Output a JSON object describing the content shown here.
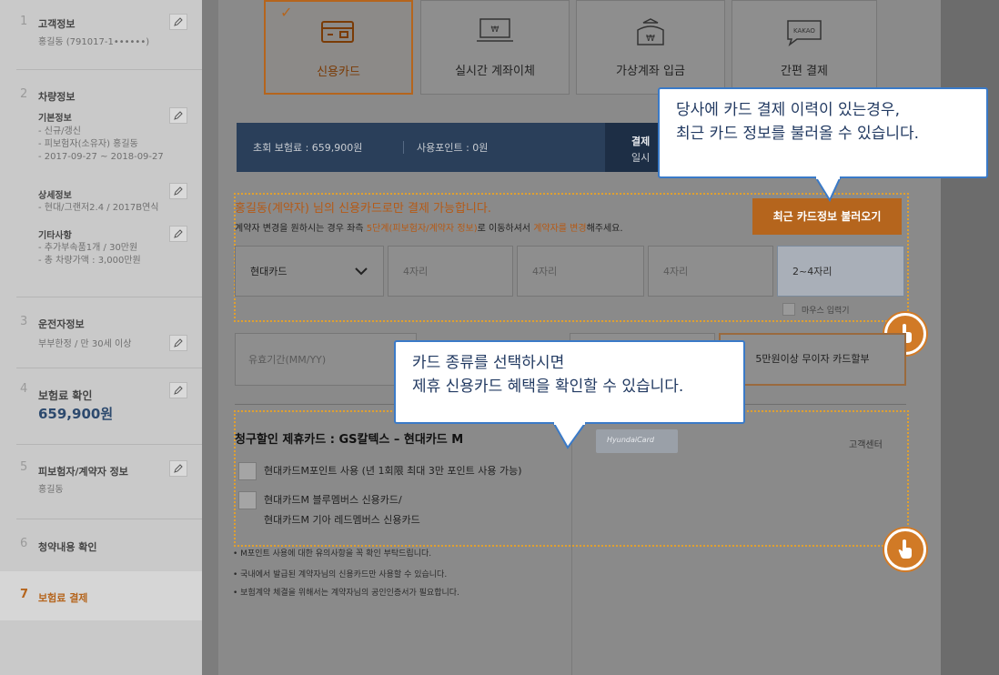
{
  "sidebar": {
    "steps": [
      {
        "num": "1",
        "title": "고객정보",
        "lines": [
          "홍길동 (791017-1••••••)"
        ]
      },
      {
        "num": "2",
        "title": "차량정보",
        "groups": [
          {
            "subtitle": "기본정보",
            "lines": [
              "- 신규/갱신",
              "- 피보험자(소유자) 홍길동",
              "- 2017-09-27 ~ 2018-09-27"
            ]
          },
          {
            "subtitle": "상세정보",
            "lines": [
              "- 현대/그랜저2.4 / 2017B연식"
            ]
          },
          {
            "subtitle": "기타사항",
            "lines": [
              "- 추가부속품1개 / 30만원",
              "- 총 차량가액 : 3,000만원"
            ]
          }
        ]
      },
      {
        "num": "3",
        "title": "운전자정보",
        "lines": [
          "부부한정 / 만 30세 이상"
        ]
      },
      {
        "num": "4",
        "title": "보험료 확인",
        "amount": "659,900원"
      },
      {
        "num": "5",
        "title": "피보험자/계약자 정보",
        "lines": [
          "홍길동"
        ]
      },
      {
        "num": "6",
        "title": "청약내용 확인"
      },
      {
        "num": "7",
        "title": "보험료 결제"
      }
    ]
  },
  "payment_tabs": [
    {
      "label": "신용카드",
      "icon": "credit-card-icon",
      "active": true
    },
    {
      "label": "실시간 계좌이체",
      "icon": "bank-transfer-icon"
    },
    {
      "label": "가상계좌 입금",
      "icon": "virtual-account-icon"
    },
    {
      "label": "간편 결제",
      "icon": "kakao-chat-icon",
      "icon_text": "KAKAO"
    }
  ],
  "info_bar": {
    "premium": "초회 보험료 : 659,900원",
    "points": "사용포인트 : 0원",
    "right_line1": "결제",
    "right_line2": "일시"
  },
  "card_section": {
    "notice": "홍길동(계약자) 님의 신용카드로만 결제 가능합니다.",
    "sub_notice_pre": "계약자 변경을 원하시는 경우 좌측 ",
    "sub_notice_step": "5단계(피보험자/계약자 정보)",
    "sub_notice_mid": "로 이동하셔서 ",
    "sub_notice_change": "계약자를 변경",
    "sub_notice_post": "해주세요.",
    "recent_button": "최근 카드정보 불러오기",
    "card_type": "현대카드",
    "card_num_placeholders": [
      "4자리",
      "4자리",
      "4자리",
      "2~4자리"
    ],
    "mouse_input_label": "마우스 입력기",
    "expiry_placeholder": "유효기간(MM/YY)",
    "installment_button": "5만원이상 무이자 카드할부"
  },
  "benefit": {
    "title": "청구할인 제휴카드 : GS칼텍스 – 현대카드 M",
    "option1": "현대카드M포인트 사용 (년 1회限 최대 3만 포인트 사용 가능)",
    "option2_line1": "현대카드M 블루멤버스 신용카드/",
    "option2_line2": "현대카드M 기아 레드멤버스 신용카드",
    "card_brand": "HyundaiCard",
    "customer_center": "고객센터"
  },
  "notes": [
    "• M포인트 사용에 대한 유의사항을 꼭 확인 부탁드립니다.",
    "• 국내에서 발급된 계약자님의 신용카드만 사용할 수 있습니다.",
    "• 보험계약 체결을 위해서는 계약자님의 공인인증서가 필요합니다."
  ],
  "tooltips": {
    "recent_card_line1": "당사에 카드 결제 이력이 있는경우,",
    "recent_card_line2": "최근 카드 정보를 불러올 수 있습니다.",
    "card_type_line1": "카드 종류를 선택하시면",
    "card_type_line2": "제휴 신용카드 혜택을 확인할 수 있습니다."
  },
  "colors": {
    "accent": "#b5651d",
    "tooltip_border": "#3a7ac8",
    "tooltip_text": "#223a62",
    "dash": "#e0a030"
  }
}
